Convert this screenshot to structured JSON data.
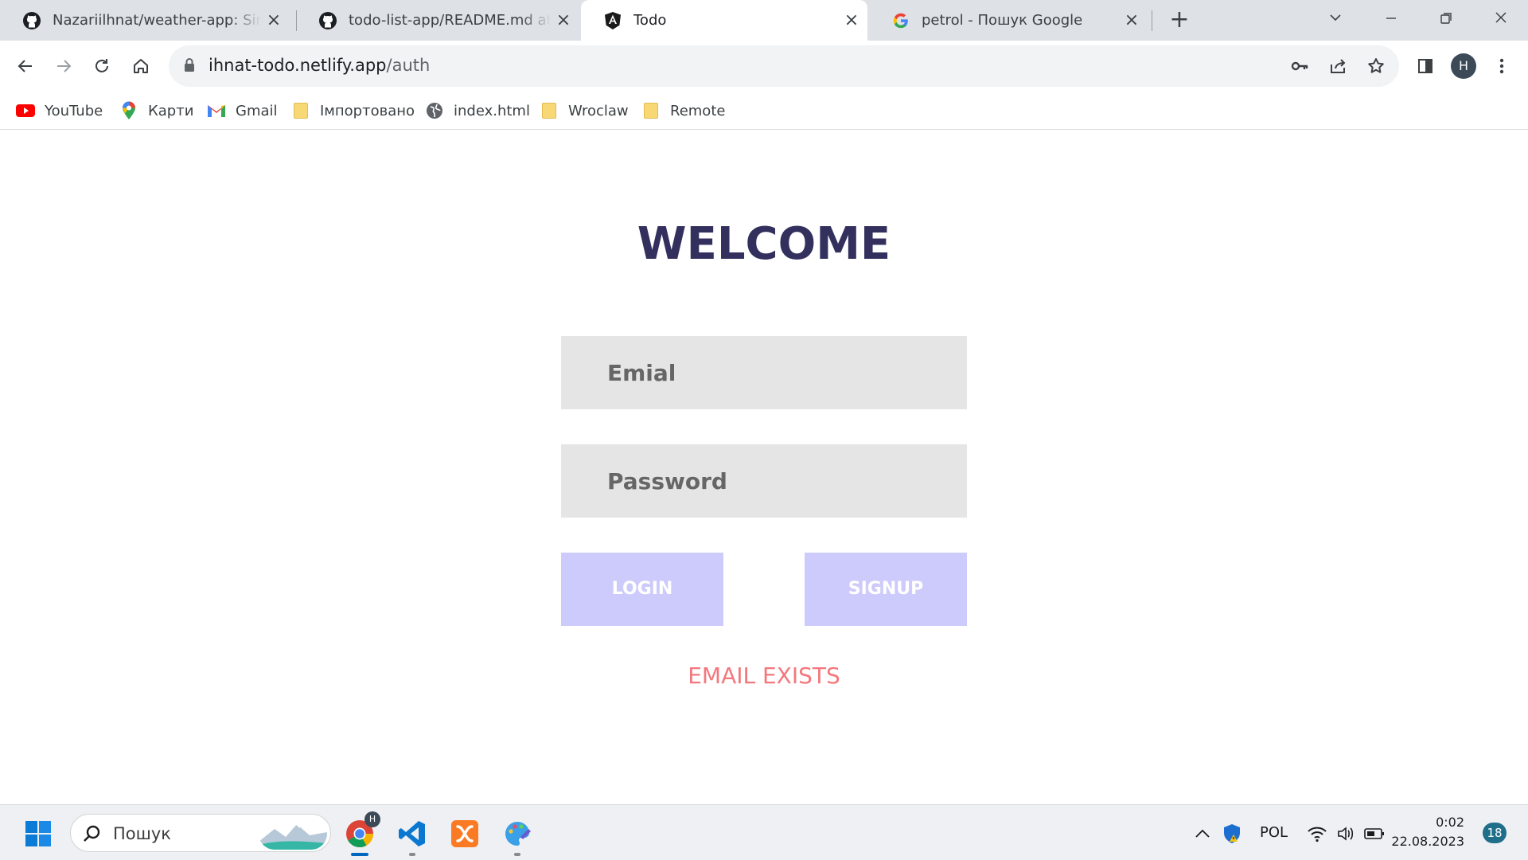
{
  "browser": {
    "tabs": [
      {
        "title": "Nazariilhnat/weather-app: Simple",
        "icon": "github-icon",
        "active": false
      },
      {
        "title": "todo-list-app/README.md at main",
        "icon": "github-icon",
        "active": false
      },
      {
        "title": "Todo",
        "icon": "angular-icon",
        "active": true
      },
      {
        "title": "petrol - Пошук Google",
        "icon": "google-icon",
        "active": false
      }
    ],
    "url": {
      "host": "ihnat-todo.netlify.app",
      "path": "/auth"
    },
    "profile_initial": "H",
    "bookmarks": [
      {
        "label": "YouTube",
        "icon": "youtube-icon"
      },
      {
        "label": "Карти",
        "icon": "maps-icon"
      },
      {
        "label": "Gmail",
        "icon": "gmail-icon"
      },
      {
        "label": "Імпортовано",
        "icon": "folder-icon"
      },
      {
        "label": "index.html",
        "icon": "globe-icon"
      },
      {
        "label": "Wroclaw",
        "icon": "folder-icon"
      },
      {
        "label": "Remote",
        "icon": "folder-icon"
      }
    ]
  },
  "auth": {
    "heading": "WELCOME",
    "email_placeholder": "Emial",
    "password_placeholder": "Password",
    "email_value": "",
    "password_value": "",
    "login_label": "LOGIN",
    "signup_label": "SIGNUP",
    "error_message": "EMAIL EXISTS"
  },
  "colors": {
    "heading": "#33305e",
    "field_bg": "#e5e5e5",
    "button_bg": "#cccbfb",
    "error": "#f4777d"
  },
  "taskbar": {
    "search_placeholder": "Пошук",
    "pinned": [
      "chrome-icon",
      "vscode-icon",
      "xampp-icon",
      "paint-icon"
    ],
    "chrome_badge": "H",
    "language": "POL",
    "time": "0:02",
    "date": "22.08.2023",
    "notification_count": "18"
  }
}
